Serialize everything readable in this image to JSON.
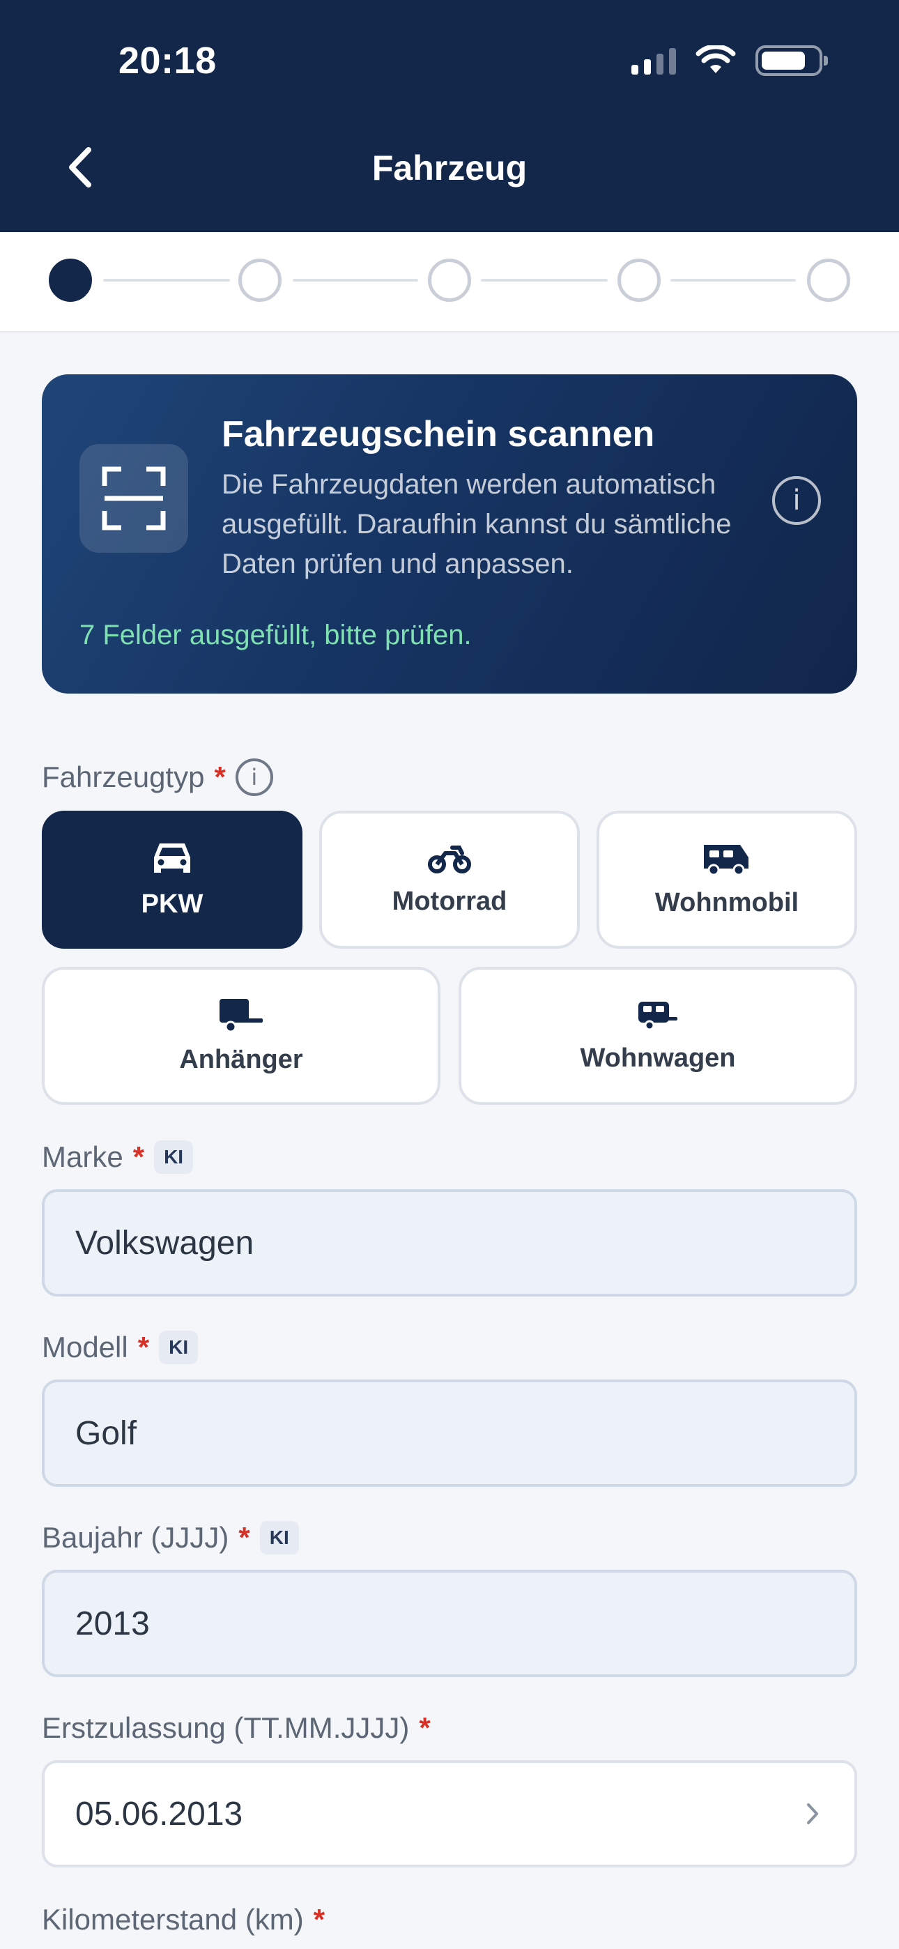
{
  "status_bar": {
    "time": "20:18"
  },
  "header": {
    "title": "Fahrzeug"
  },
  "stepper": {
    "total": 5,
    "current": 1
  },
  "scan_card": {
    "title": "Fahrzeugschein scannen",
    "description": "Die Fahrzeugdaten werden automatisch ausgefüllt. Daraufhin kannst du sämtliche Daten prüfen und anpassen.",
    "info_glyph": "i",
    "status": "7 Felder ausgefüllt, bitte prüfen."
  },
  "vehicle_type": {
    "label": "Fahrzeugtyp",
    "required_mark": "*",
    "info_glyph": "i",
    "options": [
      {
        "label": "PKW",
        "icon": "car-icon",
        "selected": true
      },
      {
        "label": "Motorrad",
        "icon": "motorcycle-icon",
        "selected": false
      },
      {
        "label": "Wohnmobil",
        "icon": "camper-van-icon",
        "selected": false
      },
      {
        "label": "Anhänger",
        "icon": "trailer-icon",
        "selected": false
      },
      {
        "label": "Wohnwagen",
        "icon": "caravan-icon",
        "selected": false
      }
    ]
  },
  "fields": {
    "marke": {
      "label": "Marke",
      "required_mark": "*",
      "badge": "KI",
      "value": "Volkswagen"
    },
    "modell": {
      "label": "Modell",
      "required_mark": "*",
      "badge": "KI",
      "value": "Golf"
    },
    "baujahr": {
      "label": "Baujahr (JJJJ)",
      "required_mark": "*",
      "badge": "KI",
      "value": "2013"
    },
    "erstzulassung": {
      "label": "Erstzulassung (TT.MM.JJJJ)",
      "required_mark": "*",
      "value": "05.06.2013"
    },
    "kilometerstand": {
      "label": "Kilometerstand (km)",
      "required_mark": "*"
    }
  },
  "colors": {
    "primary": "#13274a",
    "accent_green": "#7fe0b0",
    "required_red": "#d93025",
    "ai_field_bg": "#edf2f8"
  }
}
